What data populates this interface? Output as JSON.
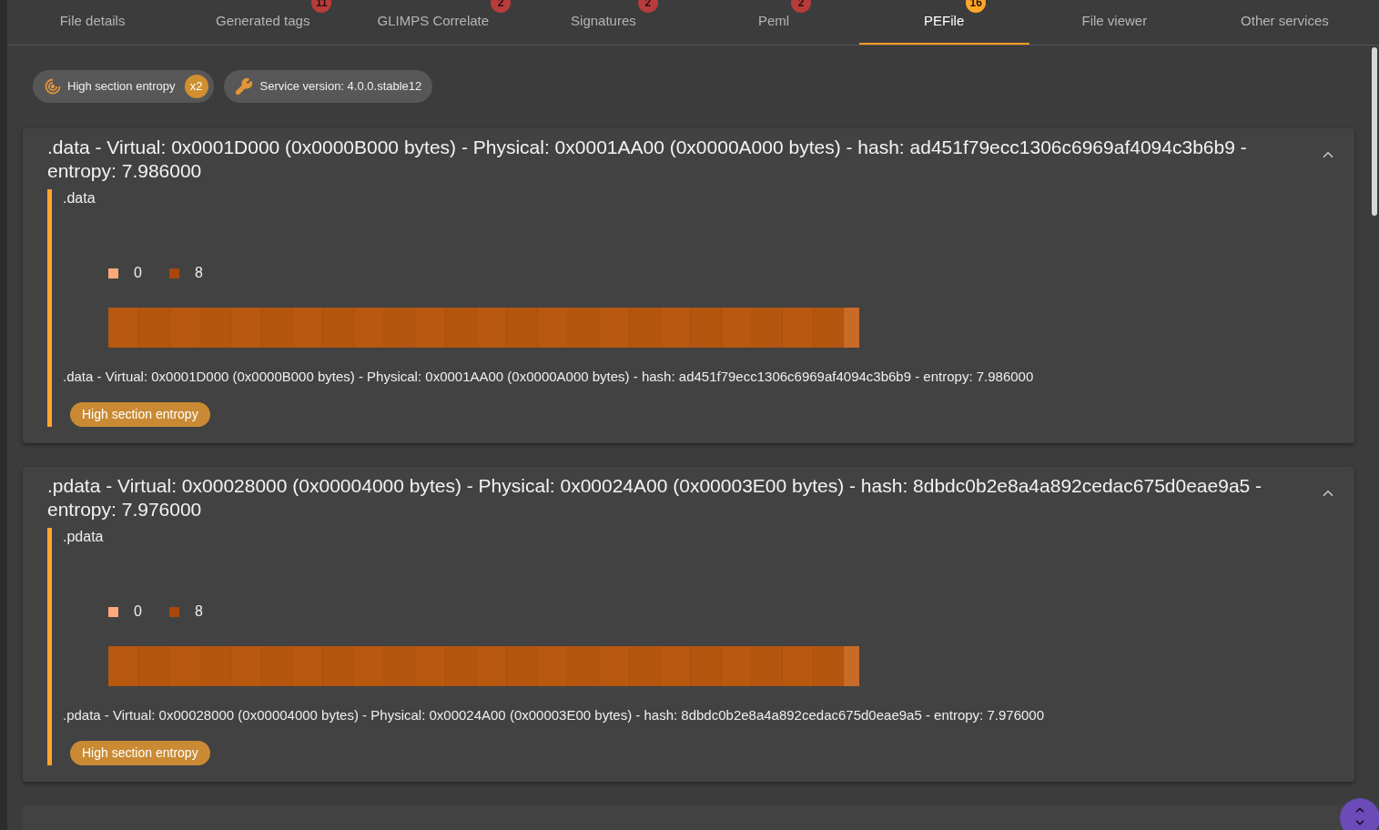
{
  "tabs": [
    {
      "label": "File details",
      "selected": false
    },
    {
      "label": "Generated tags",
      "badge": "11",
      "color": "#b83c3c",
      "selected": false
    },
    {
      "label": "GLIMPS Correlate",
      "badge": "2",
      "color": "#b83c3c",
      "selected": false
    },
    {
      "label": "Signatures",
      "badge": "2",
      "color": "#b83c3c",
      "selected": false
    },
    {
      "label": "Peml",
      "badge": "2",
      "color": "#b83c3c",
      "selected": false
    },
    {
      "label": "PEFile",
      "badge": "16",
      "color": "#ffa726",
      "selected": true
    },
    {
      "label": "File viewer",
      "selected": false
    },
    {
      "label": "Other services",
      "selected": false
    }
  ],
  "chips": [
    {
      "kind": "heuristic",
      "label": "High section entropy",
      "count": "x2"
    },
    {
      "kind": "version",
      "label": "Service version: 4.0.0.stable12"
    }
  ],
  "sections": [
    {
      "title": ".data - Virtual: 0x0001D000 (0x0000B000 bytes) - Physical: 0x0001AA00 (0x0000A000 bytes) - hash: ad451f79ecc1306c6969af4094c3b6b9 - entropy: 7.986000",
      "expanded": true,
      "name": ".data",
      "legend": [
        "0",
        "8"
      ],
      "description": ".data - Virtual: 0x0001D000 (0x0000B000 bytes) - Physical: 0x0001AA00 (0x0000A000 bytes) - hash: ad451f79ecc1306c6969af4094c3b6b9 - entropy: 7.986000",
      "tag": "High section entropy"
    },
    {
      "title": ".pdata - Virtual: 0x00028000 (0x00004000 bytes) - Physical: 0x00024A00 (0x00003E00 bytes) - hash: 8dbdc0b2e8a4a892cedac675d0eae9a5 - entropy: 7.976000",
      "expanded": true,
      "name": ".pdata",
      "legend": [
        "0",
        "8"
      ],
      "description": ".pdata - Virtual: 0x00028000 (0x00004000 bytes) - Physical: 0x00024A00 (0x00003E00 bytes) - hash: 8dbdc0b2e8a4a892cedac675d0eae9a5 - entropy: 7.976000",
      "tag": "High section entropy"
    }
  ]
}
